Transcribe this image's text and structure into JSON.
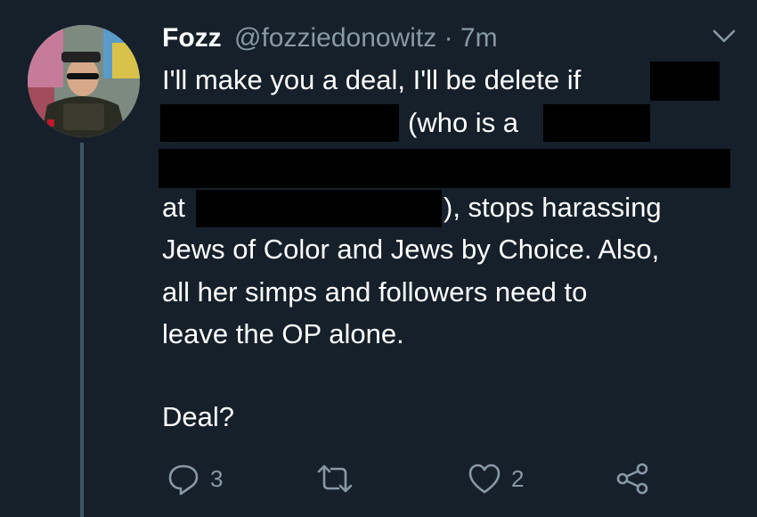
{
  "user": {
    "display_name": "Fozz",
    "handle": "@fozziedonowitz",
    "separator": "·",
    "timestamp": "7m"
  },
  "tweet": {
    "line1": "I'll make you a deal, I'll be delete if",
    "line2": "(who is a",
    "line4_prefix": "at",
    "line4_suffix": "), stops harassing",
    "line5": "Jews of Color and Jews by Choice. Also,",
    "line6": "all her simps and followers need to",
    "line7": "leave the OP alone.",
    "line8": "Deal?"
  },
  "actions": {
    "reply_count": "3",
    "like_count": "2"
  },
  "icons": {
    "menu": "chevron-down-icon",
    "reply": "reply-icon",
    "retweet": "retweet-icon",
    "like": "heart-icon",
    "share": "share-icon"
  },
  "colors": {
    "background": "#15202b",
    "text": "#ffffff",
    "muted": "#8899a6",
    "redaction": "#000000"
  }
}
